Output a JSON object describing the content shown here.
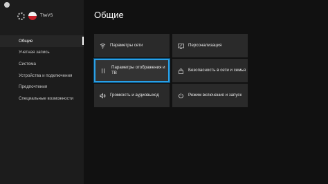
{
  "profile": {
    "gamertag": "TheVS"
  },
  "page": {
    "title": "Общие"
  },
  "nav": {
    "items": [
      {
        "label": "Общие"
      },
      {
        "label": "Учетная запись"
      },
      {
        "label": "Система"
      },
      {
        "label": "Устройства и подключения"
      },
      {
        "label": "Предпочтения"
      },
      {
        "label": "Специальные возможности"
      }
    ]
  },
  "tiles": [
    {
      "label": "Параметры сети",
      "icon": "network-icon"
    },
    {
      "label": "Персонализация",
      "icon": "personalization-icon"
    },
    {
      "label": "Параметры отображения и ТВ",
      "icon": "tv-display-icon"
    },
    {
      "label": "Безопасность в сети и семья",
      "icon": "lock-icon"
    },
    {
      "label": "Громкость и аудиовыход",
      "icon": "speaker-icon"
    },
    {
      "label": "Режим включения и запуск",
      "icon": "power-icon"
    }
  ],
  "colors": {
    "accent": "#2aa0e6",
    "background": "#111111",
    "tile": "#2a2a2a"
  }
}
